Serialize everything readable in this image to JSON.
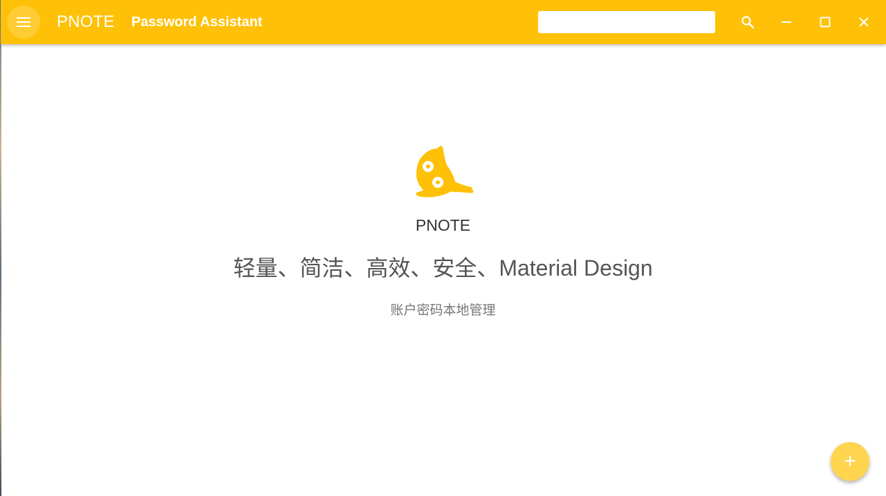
{
  "appbar": {
    "app_name": "PNOTE",
    "subtitle": "Password Assistant",
    "search": {
      "value": "",
      "placeholder": ""
    },
    "icons": {
      "menu": "menu-icon",
      "search": "search-icon",
      "minimize": "minimize-icon",
      "maximize": "maximize-icon",
      "close": "close-icon"
    }
  },
  "main": {
    "logo": "cat-logo",
    "brand": "PNOTE",
    "tagline": "轻量、简洁、高效、安全、Material Design",
    "description": "账户密码本地管理"
  },
  "fab": {
    "label": "+",
    "icon": "add-icon"
  },
  "colors": {
    "primary": "#ffc107",
    "fab": "#ffd54f",
    "text_dark": "#333333",
    "text_mid": "#555555",
    "text_light": "#777777"
  }
}
